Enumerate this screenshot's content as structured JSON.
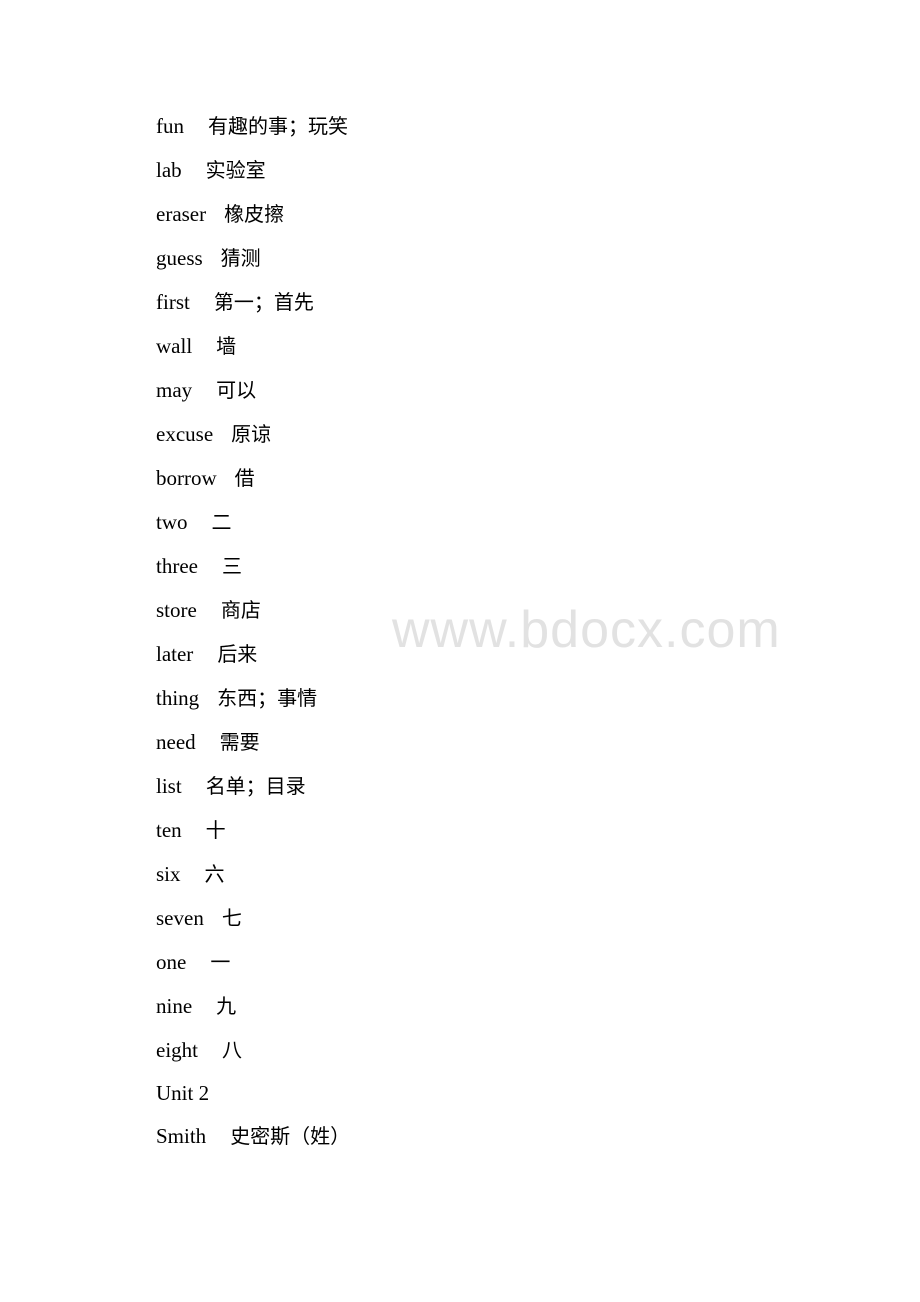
{
  "watermark": "www.bdocx.com",
  "entries": [
    {
      "word": "fun",
      "gap": 24,
      "meaning": "有趣的事；玩笑"
    },
    {
      "word": "lab",
      "gap": 24,
      "meaning": "实验室"
    },
    {
      "word": "eraser",
      "gap": 18,
      "meaning": "橡皮擦"
    },
    {
      "word": "guess",
      "gap": 18,
      "meaning": "猜测"
    },
    {
      "word": "first",
      "gap": 24,
      "meaning": "第一；首先"
    },
    {
      "word": "wall",
      "gap": 24,
      "meaning": "墙"
    },
    {
      "word": "may",
      "gap": 24,
      "meaning": "可以"
    },
    {
      "word": "excuse",
      "gap": 18,
      "meaning": "原谅"
    },
    {
      "word": "borrow",
      "gap": 18,
      "meaning": "借"
    },
    {
      "word": "two",
      "gap": 24,
      "meaning": "二"
    },
    {
      "word": "three",
      "gap": 24,
      "meaning": "三"
    },
    {
      "word": "store",
      "gap": 24,
      "meaning": "商店"
    },
    {
      "word": "later",
      "gap": 24,
      "meaning": "后来"
    },
    {
      "word": "thing",
      "gap": 18,
      "meaning": "东西；事情"
    },
    {
      "word": "need",
      "gap": 24,
      "meaning": "需要"
    },
    {
      "word": "list",
      "gap": 24,
      "meaning": "名单；目录"
    },
    {
      "word": "ten",
      "gap": 24,
      "meaning": "十"
    },
    {
      "word": "six",
      "gap": 24,
      "meaning": "六"
    },
    {
      "word": "seven",
      "gap": 18,
      "meaning": "七"
    },
    {
      "word": "one",
      "gap": 24,
      "meaning": "一"
    },
    {
      "word": "nine",
      "gap": 24,
      "meaning": "九"
    },
    {
      "word": "eight",
      "gap": 24,
      "meaning": "八"
    },
    {
      "heading": "Unit 2"
    },
    {
      "word": "Smith",
      "gap": 24,
      "meaning": "史密斯（姓）"
    }
  ]
}
